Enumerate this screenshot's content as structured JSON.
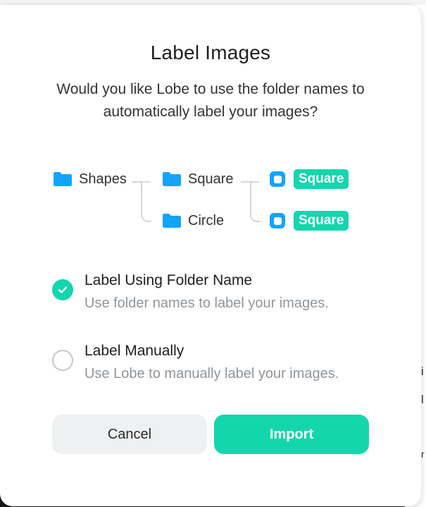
{
  "dialog": {
    "title": "Label Images",
    "subtitle": "Would you like Lobe to use the folder names to automatically label your images?"
  },
  "diagram": {
    "root_folder": "Shapes",
    "child_folders": [
      "Square",
      "Circle"
    ],
    "labels": [
      "Square",
      "Square"
    ],
    "folder_icon": "folder-icon",
    "label_icon": "image-label-icon"
  },
  "options": [
    {
      "title": "Label Using Folder Name",
      "description": "Use folder names to label your images.",
      "selected": true
    },
    {
      "title": "Label Manually",
      "description": "Use Lobe to manually label your images.",
      "selected": false
    }
  ],
  "buttons": {
    "cancel": "Cancel",
    "import": "Import"
  },
  "background_peek": [
    "i",
    "l",
    "r"
  ],
  "colors": {
    "accent": "#14d6ad",
    "folder": "#12a4ff",
    "muted_text": "#8f959c",
    "cancel_bg": "#eef0f2"
  }
}
